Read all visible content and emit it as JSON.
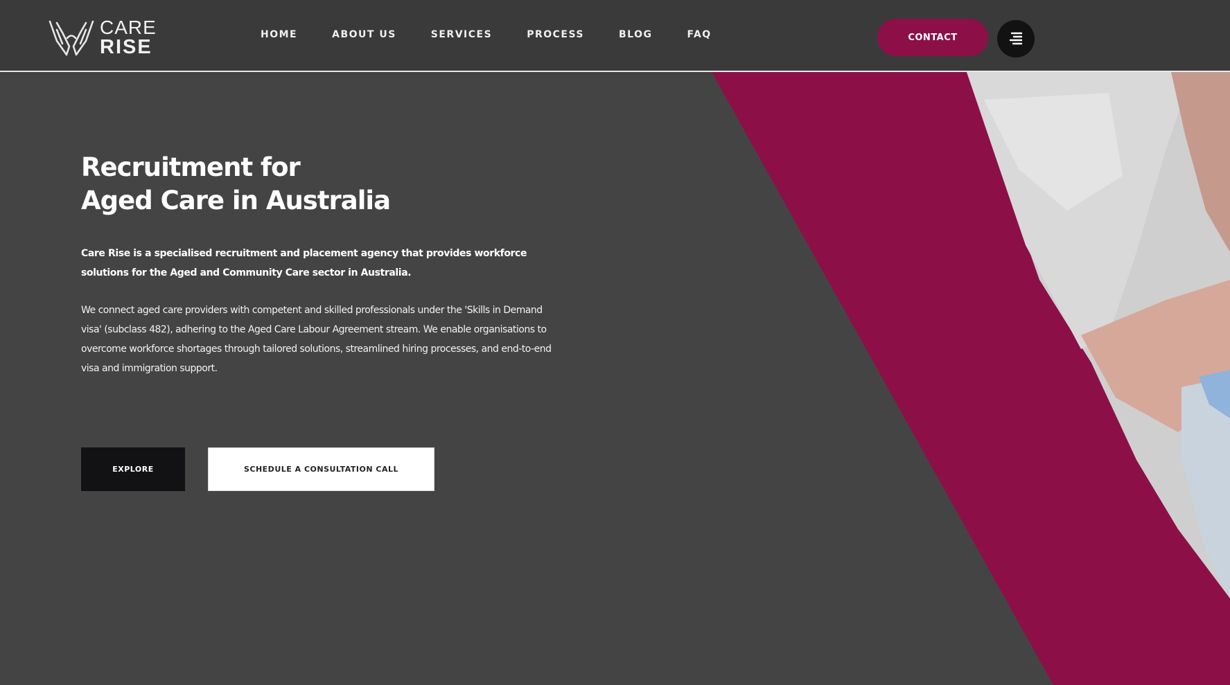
{
  "brand": {
    "line1": "CARE",
    "line2": "RISE",
    "logo_icon": "hands-icon"
  },
  "nav": {
    "items": [
      {
        "label": "HOME"
      },
      {
        "label": "ABOUT US"
      },
      {
        "label": "SERVICES"
      },
      {
        "label": "PROCESS"
      },
      {
        "label": "BLOG"
      },
      {
        "label": "FAQ"
      }
    ],
    "contact_label": "CONTACT",
    "menu_icon": "hamburger-menu-icon"
  },
  "hero": {
    "title_line1": "Recruitment for",
    "title_line2": "Aged Care in Australia",
    "paragraph1": "Care Rise is a specialised recruitment and placement agency that provides workforce solutions for the Aged and Community Care sector in Australia.",
    "paragraph2": "We connect aged care providers with competent and skilled professionals under the 'Skills in Demand visa' (subclass 482), adhering to the Aged Care Labour Agreement stream. We enable organisations to overcome workforce shortages through tailored solutions, streamlined hiring processes, and end-to-end visa and immigration support.",
    "explore_label": "EXPLORE",
    "schedule_label": "SCHEDULE A CONSULTATION CALL"
  },
  "colors": {
    "background": "#444444",
    "header": "#3a3a3a",
    "accent": "#8c1047",
    "dark_button": "#121214"
  }
}
